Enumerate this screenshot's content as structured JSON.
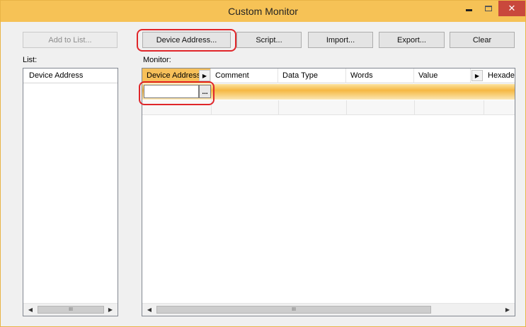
{
  "window": {
    "title": "Custom Monitor",
    "accent_color": "#f6c256",
    "close_color": "#c9483c",
    "minimize_icon": "minimize-icon",
    "maximize_icon": "maximize-icon",
    "close_icon": "close-icon",
    "close_glyph": "✕"
  },
  "toolbar": {
    "add_to_list": "Add to List...",
    "device_address": "Device Address...",
    "script": "Script...",
    "import": "Import...",
    "export": "Export...",
    "clear": "Clear"
  },
  "labels": {
    "list": "List:",
    "monitor": "Monitor:"
  },
  "list_panel": {
    "column_header": "Device Address",
    "scroll_thumb": "III",
    "left_arrow": "◀",
    "right_arrow": "▶"
  },
  "monitor_grid": {
    "columns": [
      "Device Address",
      "Comment",
      "Data Type",
      "Words",
      "Value",
      "Hexadecimal"
    ],
    "column_arrow": "▶",
    "edit_value": "",
    "browse_label": "...",
    "scroll_thumb": "III",
    "left_arrow": "◀",
    "right_arrow": "▶"
  }
}
